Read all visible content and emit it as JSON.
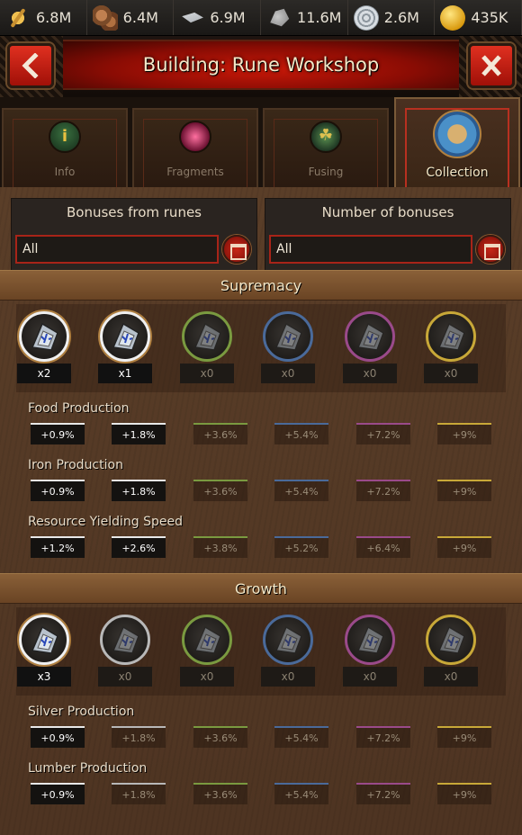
{
  "resources": [
    {
      "icon": "wheat-icon",
      "cls": "wheat",
      "value": "6.8M"
    },
    {
      "icon": "lumber-icon",
      "cls": "wood",
      "value": "6.4M"
    },
    {
      "icon": "iron-icon",
      "cls": "iron",
      "value": "6.9M"
    },
    {
      "icon": "stone-icon",
      "cls": "stone",
      "value": "11.6M"
    },
    {
      "icon": "silver-icon",
      "cls": "silver",
      "value": "2.6M"
    },
    {
      "icon": "gold-coin-icon",
      "cls": "gold",
      "value": "435K"
    }
  ],
  "header": {
    "title": "Building: Rune Workshop"
  },
  "tabs": [
    {
      "label": "Info"
    },
    {
      "label": "Fragments"
    },
    {
      "label": "Fusing"
    },
    {
      "label": "Collection"
    }
  ],
  "filters": {
    "bonuses": {
      "label": "Bonuses from runes",
      "value": "All"
    },
    "count": {
      "label": "Number of bonuses",
      "value": "All"
    }
  },
  "colors": {
    "grey": "#777777",
    "green": "#6a8a3a",
    "blue": "#3a5a8a",
    "purple": "#8a3a7a",
    "gold": "#b89a30"
  },
  "sections": [
    {
      "title": "Supremacy",
      "rune_counts": [
        "x2",
        "x1",
        "x0",
        "x0",
        "x0",
        "x0"
      ],
      "rows": [
        {
          "label": "Food Production",
          "values": [
            "+0.9%",
            "+1.8%",
            "+3.6%",
            "+5.4%",
            "+7.2%",
            "+9%"
          ],
          "active": 2
        },
        {
          "label": "Iron Production",
          "values": [
            "+0.9%",
            "+1.8%",
            "+3.6%",
            "+5.4%",
            "+7.2%",
            "+9%"
          ],
          "active": 2
        },
        {
          "label": "Resource Yielding Speed",
          "values": [
            "+1.2%",
            "+2.6%",
            "+3.8%",
            "+5.2%",
            "+6.4%",
            "+9%"
          ],
          "active": 2
        }
      ]
    },
    {
      "title": "Growth",
      "rune_counts": [
        "x3",
        "x0",
        "x0",
        "x0",
        "x0",
        "x0"
      ],
      "rows": [
        {
          "label": "Silver Production",
          "values": [
            "+0.9%",
            "+1.8%",
            "+3.6%",
            "+5.4%",
            "+7.2%",
            "+9%"
          ],
          "active": 1
        },
        {
          "label": "Lumber Production",
          "values": [
            "+0.9%",
            "+1.8%",
            "+3.6%",
            "+5.4%",
            "+7.2%",
            "+9%"
          ],
          "active": 1
        }
      ]
    }
  ]
}
